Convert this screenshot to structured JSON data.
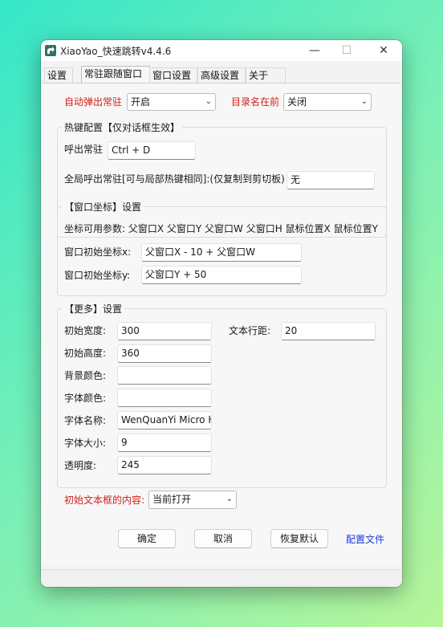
{
  "window": {
    "title": "XiaoYao_快速跳转v4.4.6",
    "minimize": "—",
    "maximize": "☐",
    "close": "✕"
  },
  "tabs": [
    {
      "label": "设置"
    },
    {
      "label": "常驻跟随窗口",
      "active": true
    },
    {
      "label": "窗口设置"
    },
    {
      "label": "高级设置"
    },
    {
      "label": "关于"
    }
  ],
  "top": {
    "auto_popup_label": "自动弹出常驻",
    "auto_popup_value": "开启",
    "dir_first_label": "目录名在前",
    "dir_first_value": "关闭"
  },
  "hotkey": {
    "group_title": "热键配置【仅对话框生效】",
    "call_label": "呼出常驻",
    "call_value": "Ctrl + D",
    "global_label": "全局呼出常驻[可与局部热键相同]:(仅复制到剪切板)",
    "global_value": "无"
  },
  "coords": {
    "group_title": "【窗口坐标】设置",
    "params_text": "坐标可用参数:  父窗口X 父窗口Y 父窗口W 父窗口H 鼠标位置X 鼠标位置Y",
    "x_label": "窗口初始坐标x:",
    "x_value": "父窗口X - 10 + 父窗口W",
    "y_label": "窗口初始坐标y:",
    "y_value": "父窗口Y + 50"
  },
  "more": {
    "group_title": "【更多】设置",
    "width_label": "初始宽度:",
    "width_value": "300",
    "line_spacing_label": "文本行距:",
    "line_spacing_value": "20",
    "height_label": "初始高度:",
    "height_value": "360",
    "bg_color_label": "背景颜色:",
    "bg_color_value": "",
    "font_color_label": "字体颜色:",
    "font_color_value": "",
    "font_name_label": "字体名称:",
    "font_name_value": "WenQuanYi Micro H",
    "font_size_label": "字体大小:",
    "font_size_value": "9",
    "opacity_label": "透明度:",
    "opacity_value": "245"
  },
  "initial": {
    "label": "初始文本框的内容:",
    "value": "当前打开"
  },
  "buttons": {
    "ok": "确定",
    "cancel": "取消",
    "reset": "恢复默认",
    "config_file": "配置文件"
  },
  "colors": {
    "accent_red": "#d1201a",
    "link_blue": "#1a3bdc"
  }
}
